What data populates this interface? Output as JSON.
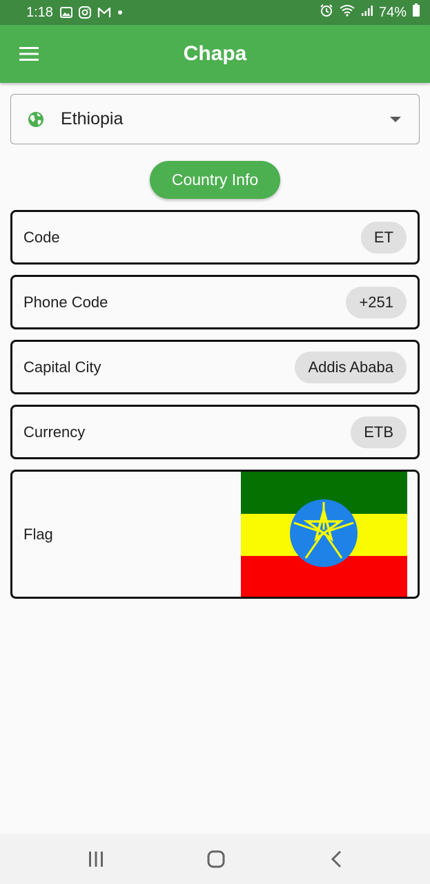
{
  "status_bar": {
    "time": "1:18",
    "battery": "74%",
    "icons": [
      "gallery-icon",
      "instagram-icon",
      "gmail-icon",
      "dot-icon",
      "alarm-icon",
      "wifi-icon",
      "signal-icon",
      "battery-icon"
    ]
  },
  "app_bar": {
    "title": "Chapa",
    "menu_icon": "menu-icon",
    "background": "#4caf50"
  },
  "country_select": {
    "value": "Ethiopia",
    "leading_icon": "globe-icon",
    "trailing_icon": "dropdown-caret-icon"
  },
  "country_info_button": {
    "label": "Country Info"
  },
  "info_rows": [
    {
      "label": "Code",
      "value": "ET"
    },
    {
      "label": "Phone Code",
      "value": "+251"
    },
    {
      "label": "Capital City",
      "value": "Addis Ababa"
    },
    {
      "label": "Currency",
      "value": "ETB"
    }
  ],
  "flag_row": {
    "label": "Flag",
    "image": "ethiopia-flag",
    "colors": {
      "green": "#047100",
      "yellow": "#fafa00",
      "red": "#fa0000",
      "emblem_blue": "#1e82e6",
      "star": "#fafa00"
    }
  },
  "nav_bar": {
    "buttons": [
      "recent-apps-icon",
      "home-icon",
      "back-icon"
    ]
  },
  "theme": {
    "status_bar": "#3e8a41",
    "primary": "#4caf50",
    "chip_bg": "#e0e0e0"
  }
}
